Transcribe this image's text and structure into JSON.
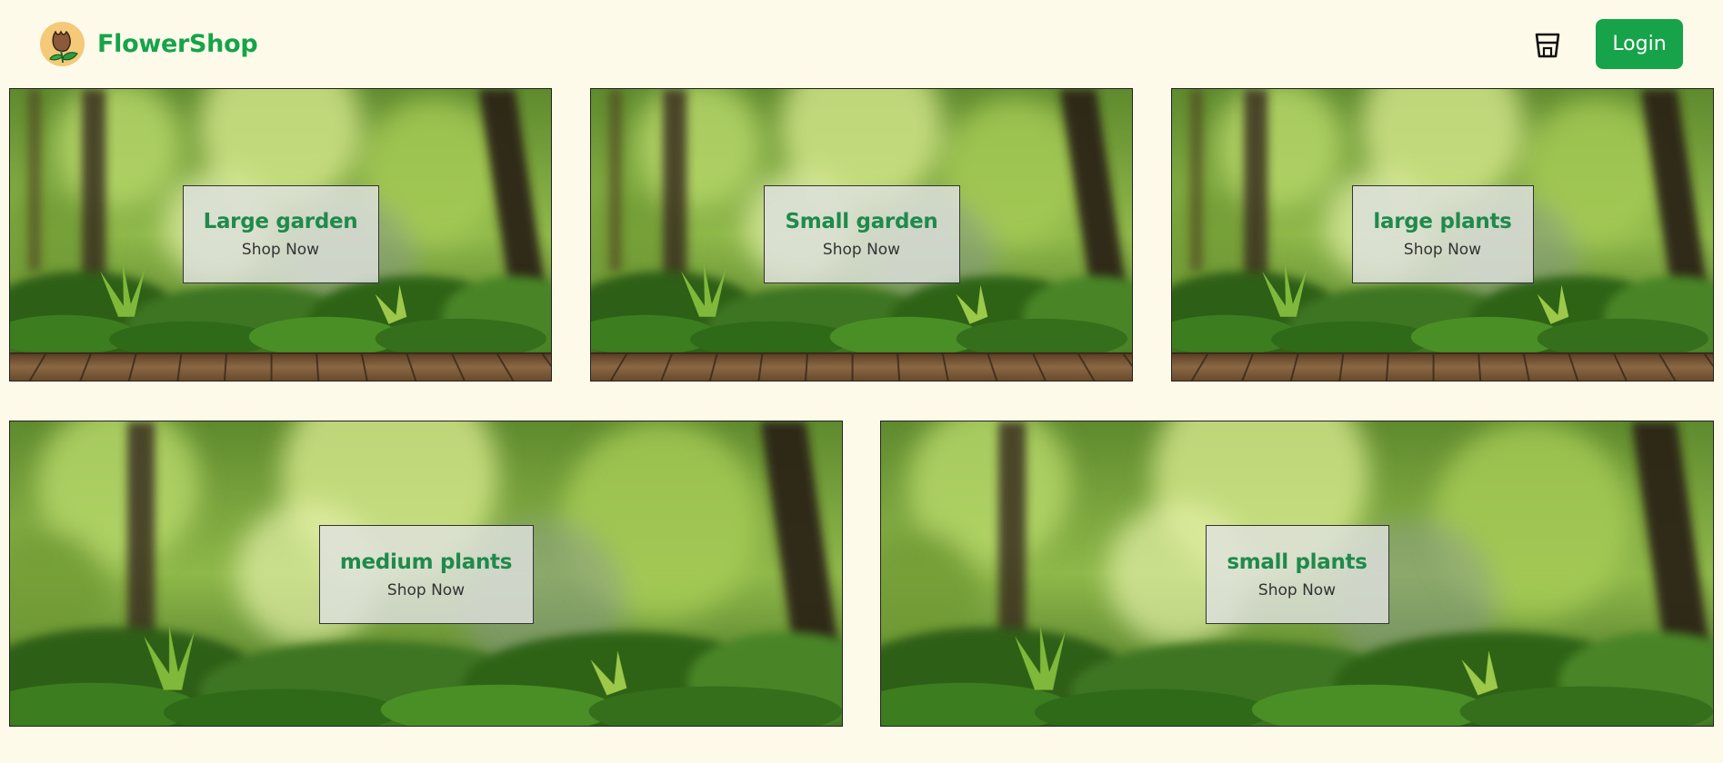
{
  "brand": {
    "name": "FlowerShop",
    "logo_icon": "flower-logo-icon"
  },
  "nav": {
    "cart_icon": "cart-icon",
    "login_label": "Login"
  },
  "colors": {
    "accent": "#16a34a",
    "label_title": "#1f8a4c",
    "background": "#fefae9"
  },
  "categories": [
    {
      "title": "Large garden",
      "cta": "Shop Now"
    },
    {
      "title": "Small garden",
      "cta": "Shop Now"
    },
    {
      "title": "large plants",
      "cta": "Shop Now"
    },
    {
      "title": "medium plants",
      "cta": "Shop Now"
    },
    {
      "title": "small plants",
      "cta": "Shop Now"
    }
  ]
}
